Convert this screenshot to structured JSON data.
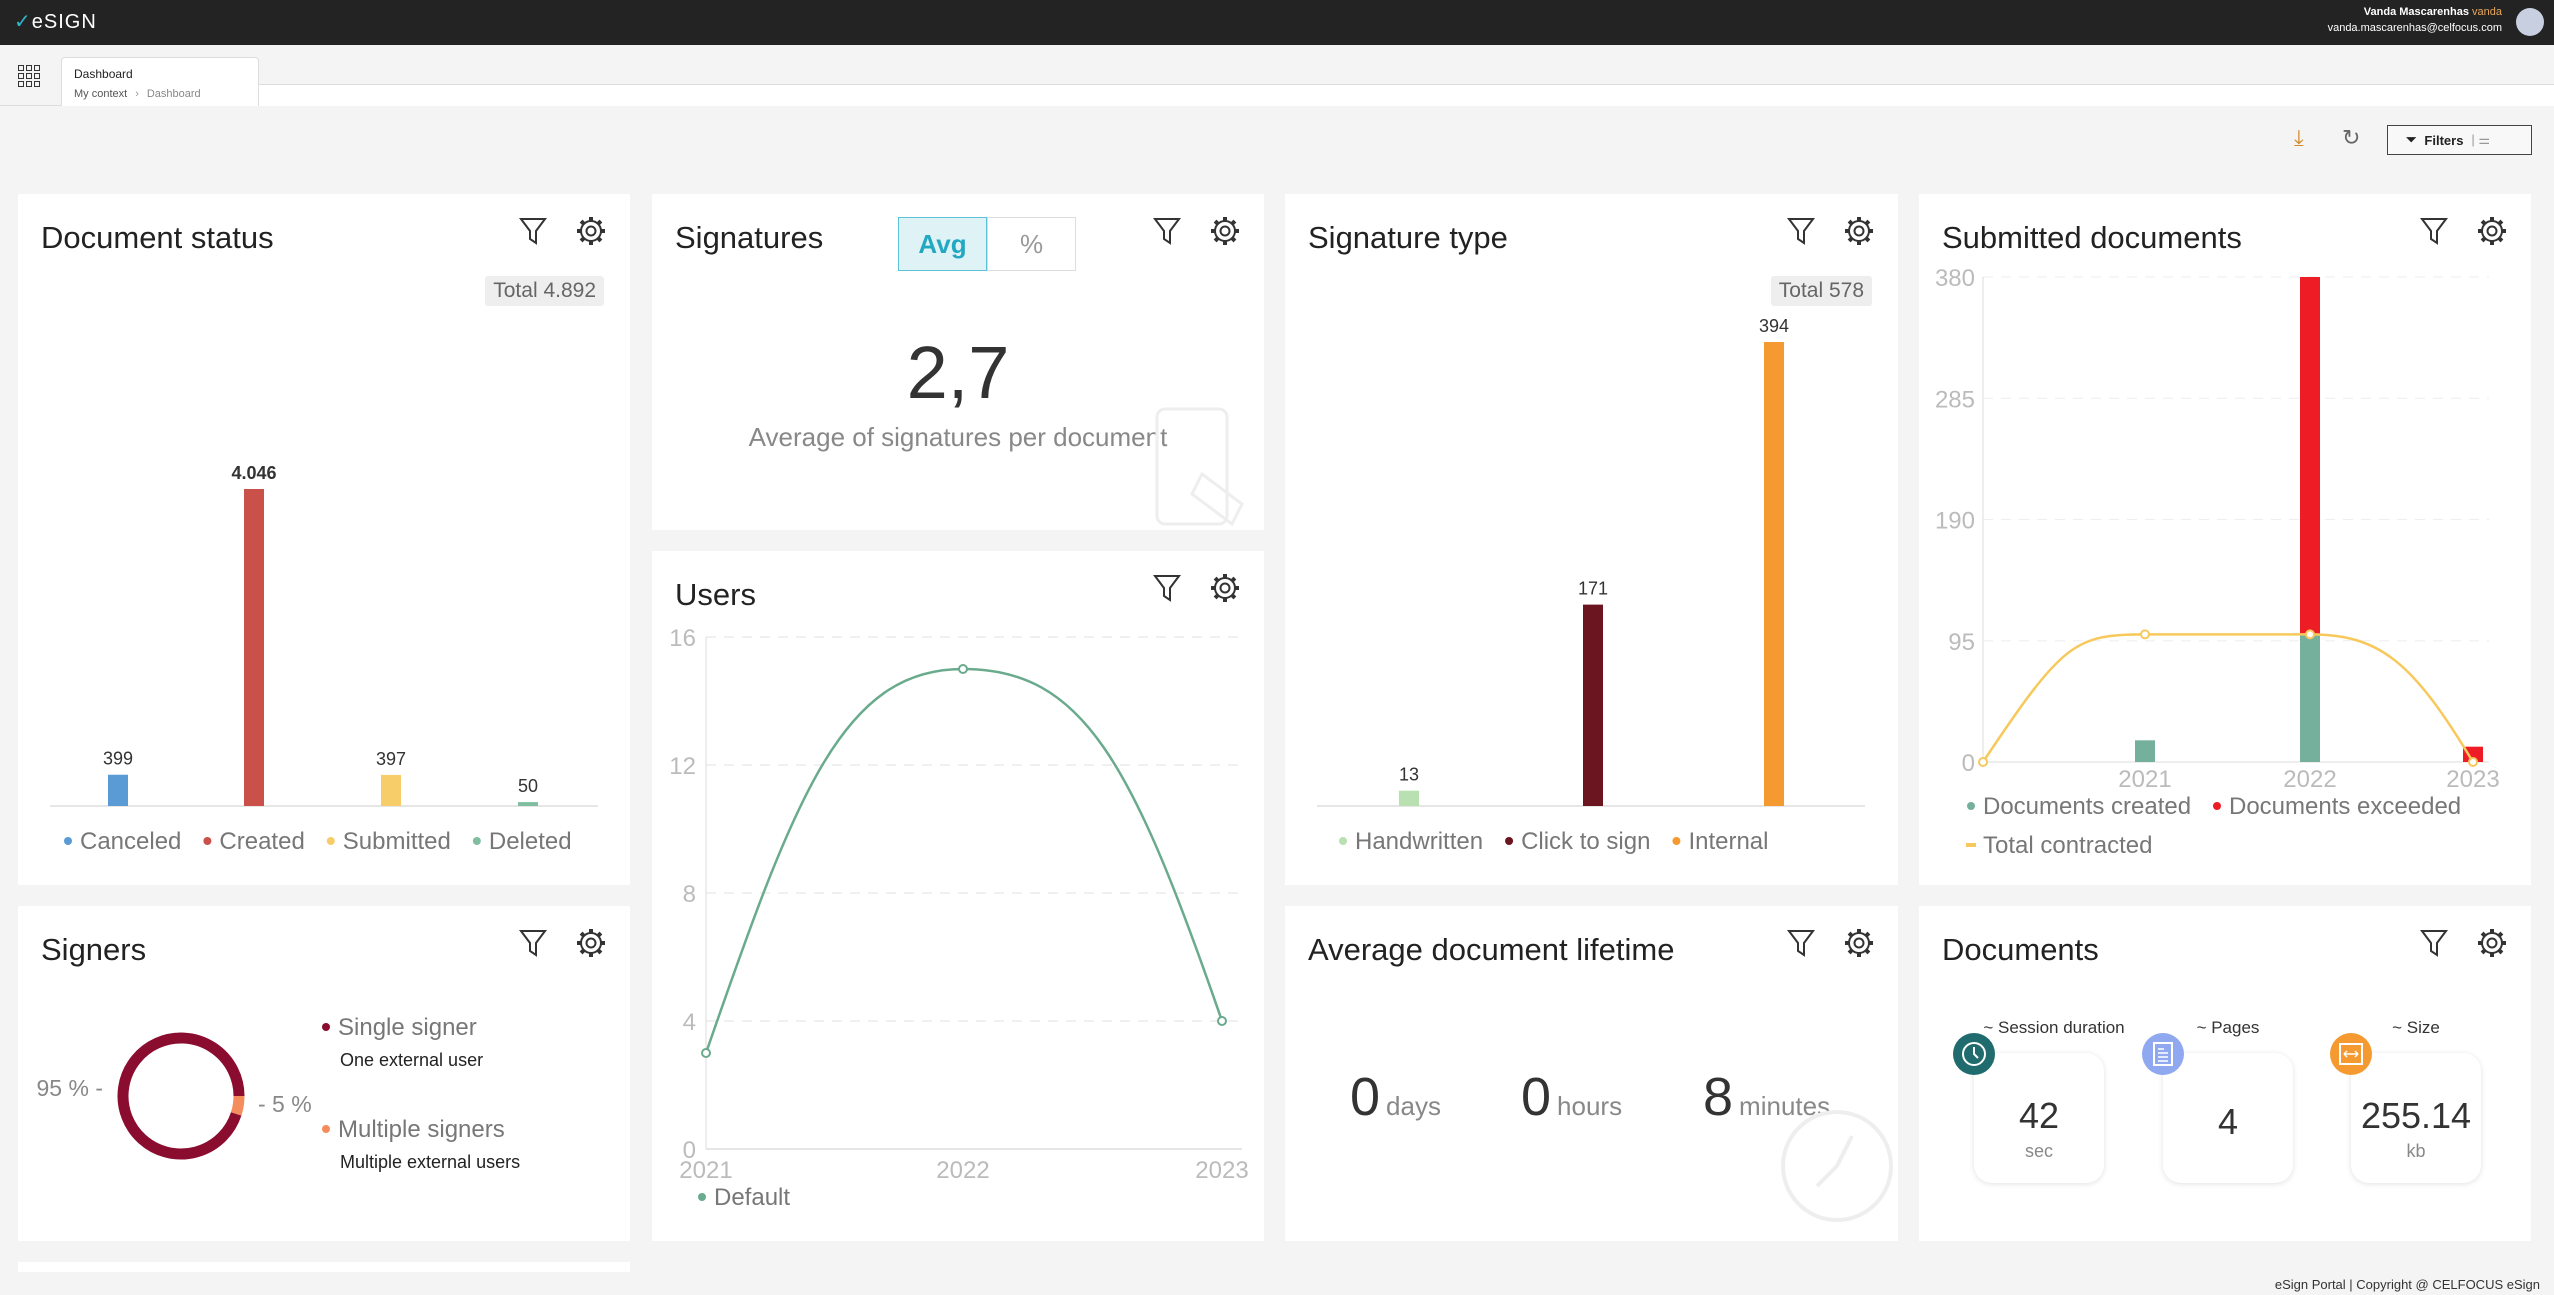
{
  "app": {
    "logo": "eSIGN",
    "user_name": "Vanda Mascarenhas",
    "username": "vanda",
    "email": "vanda.mascarenhas@celfocus.com"
  },
  "tab": {
    "label": "Dashboard"
  },
  "breadcrumb": [
    "My context",
    "Dashboard"
  ],
  "toolbar": {
    "filters_label": "Filters",
    "icons": [
      "download-icon",
      "refresh-icon",
      "filter-icon",
      "sliders-icon"
    ]
  },
  "document_status": {
    "title": "Document status",
    "total": "Total 4.892"
  },
  "signatures": {
    "title": "Signatures",
    "toggle": [
      "Avg",
      "%"
    ],
    "selected": "Avg",
    "value": "2,7",
    "caption": "Average of signatures per document"
  },
  "users": {
    "title": "Users"
  },
  "signature_type": {
    "title": "Signature type",
    "total": "Total 578"
  },
  "submitted": {
    "title": "Submitted documents"
  },
  "signers": {
    "title": "Signers",
    "items": [
      {
        "label": "Single signer",
        "desc": "One external user",
        "pct": "95 %",
        "value": 95,
        "color": "#8a0c2e"
      },
      {
        "label": "Multiple signers",
        "desc": "Multiple external users",
        "pct": "5 %",
        "value": 5,
        "color": "#f58c5c"
      }
    ]
  },
  "lifetime": {
    "title": "Average document lifetime",
    "days": "0",
    "days_unit": "days",
    "hours": "0",
    "hours_unit": "hours",
    "minutes": "8",
    "minutes_unit": "minutes"
  },
  "documents": {
    "title": "Documents",
    "metrics": [
      {
        "label": "~ Session duration",
        "value": "42",
        "unit": "sec",
        "icon": "clock-icon",
        "color": "#1f6b6e"
      },
      {
        "label": "~ Pages",
        "value": "4",
        "unit": "",
        "icon": "document-icon",
        "color": "#8fa8ef"
      },
      {
        "label": "~ Size",
        "value": "255.14",
        "unit": "kb",
        "icon": "resize-icon",
        "color": "#f59a30"
      }
    ]
  },
  "footer": "eSign Portal | Copyright @ CELFOCUS eSign",
  "chart_data": [
    {
      "type": "bar",
      "categories": [
        "Canceled",
        "Created",
        "Submitted",
        "Deleted"
      ],
      "values": [
        399,
        4046,
        397,
        50
      ],
      "labels": [
        "399",
        "4.046",
        "397",
        "50"
      ],
      "colors": [
        "#5b9bd5",
        "#c9514a",
        "#f7cd6a",
        "#7fbf9f"
      ],
      "legend": "bottom"
    },
    {
      "type": "line",
      "categories": [
        "2021",
        "2022",
        "2023"
      ],
      "series": [
        {
          "name": "Default",
          "values": [
            3,
            15,
            4
          ],
          "color": "#6aaa8d"
        }
      ],
      "yticks": [
        0,
        4,
        8,
        12,
        16
      ],
      "ylim": [
        0,
        16
      ],
      "grid": true,
      "legend": "bottom"
    },
    {
      "type": "bar",
      "categories": [
        "Handwritten",
        "Click to sign",
        "Internal"
      ],
      "values": [
        13,
        171,
        394
      ],
      "labels": [
        "13",
        "171",
        "394"
      ],
      "colors": [
        "#b8e0b0",
        "#6b1520",
        "#f59a30"
      ],
      "legend": "bottom"
    },
    {
      "type": "bar",
      "categories": [
        "",
        "2021",
        "2022",
        "2023"
      ],
      "stacked": true,
      "series": [
        {
          "name": "Documents created",
          "values": [
            0,
            17,
            100,
            0
          ],
          "color": "#74b09b"
        },
        {
          "name": "Documents exceeded",
          "values": [
            0,
            0,
            280,
            12
          ],
          "color": "#ee1c25"
        },
        {
          "name": "Total contracted",
          "type": "line",
          "values": [
            0,
            100,
            100,
            0
          ],
          "color": "#f7c95c"
        }
      ],
      "yticks": [
        0,
        95,
        190,
        285,
        380
      ],
      "ylim": [
        0,
        380
      ],
      "grid": true,
      "legend": "bottom"
    },
    {
      "type": "pie",
      "donut": true,
      "categories": [
        "Single signer",
        "Multiple signers"
      ],
      "values": [
        95,
        5
      ]
    }
  ]
}
